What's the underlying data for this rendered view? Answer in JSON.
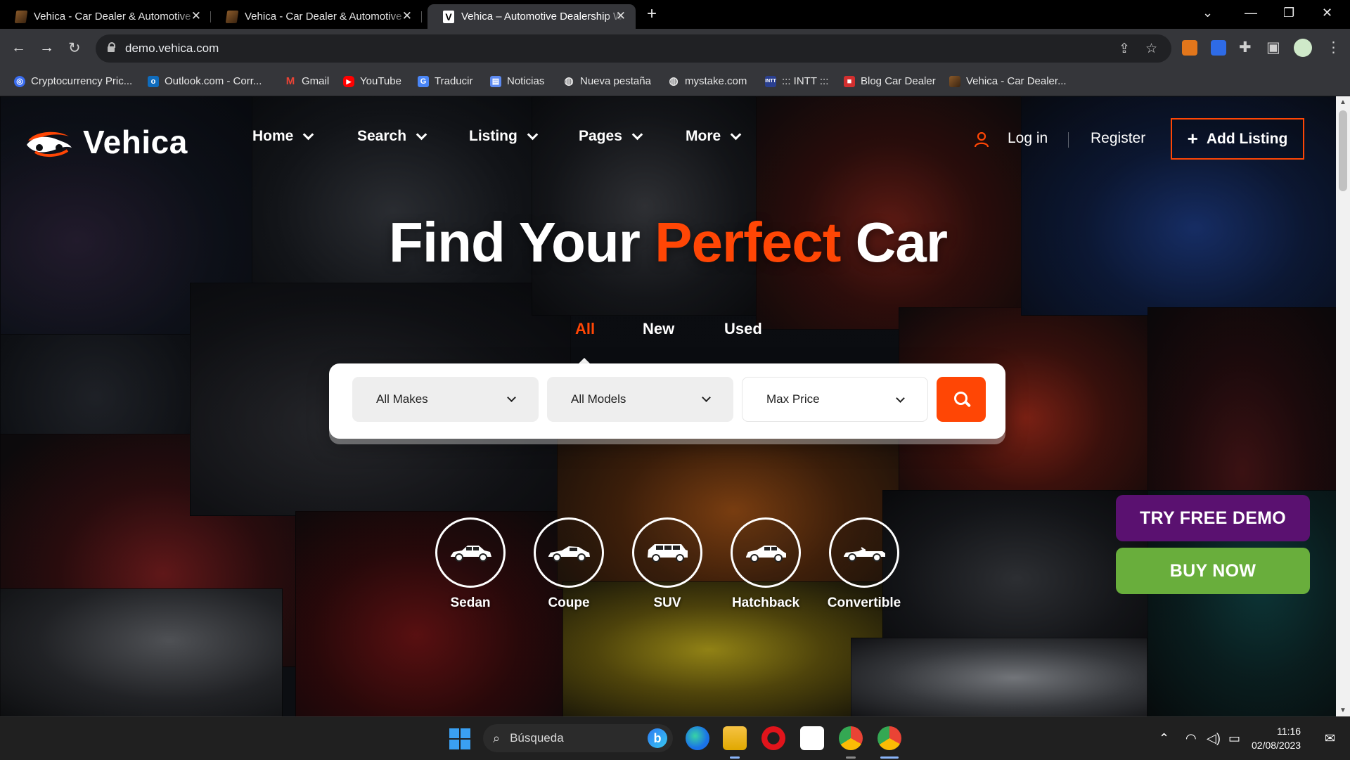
{
  "browser": {
    "tabs": [
      {
        "title": "Vehica - Car Dealer & Automotive",
        "active": false
      },
      {
        "title": "Vehica - Car Dealer & Automotive",
        "active": false
      },
      {
        "title": "Vehica – Automotive Dealership WordPress",
        "active": true
      }
    ],
    "new_tab": "+",
    "url": "demo.vehica.com",
    "bookmarks": [
      {
        "label": "Cryptocurrency Pric...",
        "icon": "coin-icon",
        "color": "#3a6df0"
      },
      {
        "label": "Outlook.com - Corr...",
        "icon": "outlook-icon",
        "color": "#0f6cbd"
      },
      {
        "label": "Gmail",
        "icon": "gmail-icon",
        "color": "#ea4335"
      },
      {
        "label": "YouTube",
        "icon": "youtube-icon",
        "color": "#ff0000"
      },
      {
        "label": "Traducir",
        "icon": "translate-icon",
        "color": "#4a86f7"
      },
      {
        "label": "Noticias",
        "icon": "news-icon",
        "color": "#5d8af0"
      },
      {
        "label": "Nueva pestaña",
        "icon": "globe-icon",
        "color": "#e8e8e8"
      },
      {
        "label": "mystake.com",
        "icon": "globe-icon",
        "color": "#e8e8e8"
      },
      {
        "label": "::: INTT :::",
        "icon": "intt-icon",
        "color": "#2a3f8f"
      },
      {
        "label": "Blog Car Dealer",
        "icon": "blog-icon",
        "color": "#d32f2f"
      },
      {
        "label": "Vehica - Car Dealer...",
        "icon": "book-icon",
        "color": "#8a5a2a"
      }
    ]
  },
  "site": {
    "logo_text": "Vehica",
    "menu": [
      {
        "label": "Home"
      },
      {
        "label": "Search"
      },
      {
        "label": "Listing"
      },
      {
        "label": "Pages"
      },
      {
        "label": "More"
      }
    ],
    "login": "Log in",
    "register": "Register",
    "add_listing": "Add Listing"
  },
  "hero": {
    "title_pre": "Find Your ",
    "title_highlight": "Perfect",
    "title_post": " Car",
    "condition_tabs": [
      {
        "label": "All",
        "active": true
      },
      {
        "label": "New",
        "active": false
      },
      {
        "label": "Used",
        "active": false
      }
    ],
    "filters": {
      "make": "All Makes",
      "model": "All Models",
      "price": "Max Price"
    }
  },
  "body_types": [
    {
      "label": "Sedan",
      "icon": "sedan-icon"
    },
    {
      "label": "Coupe",
      "icon": "coupe-icon"
    },
    {
      "label": "SUV",
      "icon": "suv-icon"
    },
    {
      "label": "Hatchback",
      "icon": "hatchback-icon"
    },
    {
      "label": "Convertible",
      "icon": "convertible-icon"
    }
  ],
  "promo": {
    "try_demo": "TRY FREE DEMO",
    "buy_now": "BUY NOW"
  },
  "taskbar": {
    "search_placeholder": "Búsqueda",
    "time": "11:16",
    "date": "02/08/2023"
  },
  "colors": {
    "accent": "#ff4605",
    "demo_purple": "#5a1170",
    "buy_green": "#69ae3c"
  }
}
